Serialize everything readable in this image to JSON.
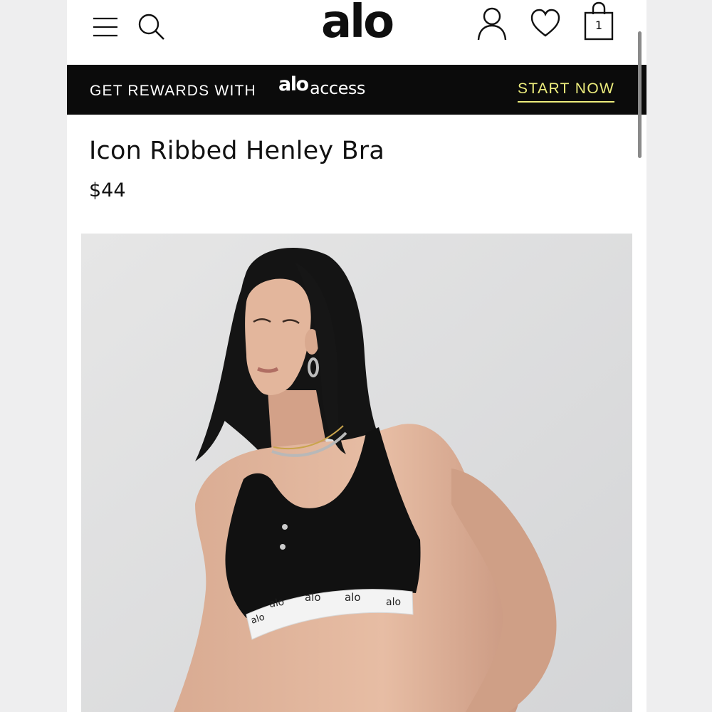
{
  "header": {
    "brand": "alo",
    "cart_count": "1",
    "icons": [
      "menu-icon",
      "search-icon",
      "account-icon",
      "heart-icon",
      "bag-icon"
    ]
  },
  "banner": {
    "text": "GET REWARDS WITH",
    "logo_brand": "alo",
    "logo_access": "access",
    "cta": "START NOW",
    "cta_color": "#ecec7c",
    "background": "#0b0b0b"
  },
  "product": {
    "title": "Icon Ribbed Henley Bra",
    "price": "$44",
    "band_logos": [
      "alo",
      "alo",
      "alo",
      "alo",
      "alo"
    ]
  }
}
